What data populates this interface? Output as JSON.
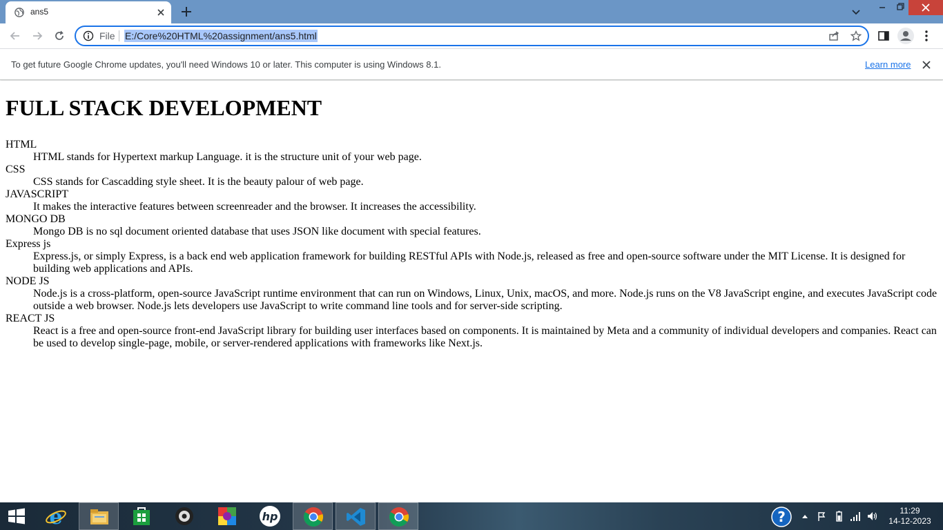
{
  "browser": {
    "tab_title": "ans5",
    "address_scheme": "File",
    "url": "E:/Core%20HTML%20assignment/ans5.html"
  },
  "infobar": {
    "message": "To get future Google Chrome updates, you'll need Windows 10 or later. This computer is using Windows 8.1.",
    "link": "Learn more"
  },
  "page": {
    "heading": "FULL STACK DEVELOPMENT",
    "items": [
      {
        "term": "HTML",
        "desc": "HTML stands for Hypertext markup Language. it is the structure unit of your web page."
      },
      {
        "term": "CSS",
        "desc": "CSS stands for Cascadding style sheet. It is the beauty palour of web page."
      },
      {
        "term": "JAVASCRIPT",
        "desc": "It makes the interactive features between screenreader and the browser. It increases the accessibility."
      },
      {
        "term": "MONGO DB",
        "desc": "Mongo DB is no sql document oriented database that uses JSON like document with special features."
      },
      {
        "term": "Express js",
        "desc": "Express.js, or simply Express, is a back end web application framework for building RESTful APIs with Node.js, released as free and open-source software under the MIT License. It is designed for building web applications and APIs."
      },
      {
        "term": "NODE JS",
        "desc": "Node.js is a cross-platform, open-source JavaScript runtime environment that can run on Windows, Linux, Unix, macOS, and more. Node.js runs on the V8 JavaScript engine, and executes JavaScript code outside a web browser. Node.js lets developers use JavaScript to write command line tools and for server-side scripting."
      },
      {
        "term": "REACT JS",
        "desc": "React is a free and open-source front-end JavaScript library for building user interfaces based on components. It is maintained by Meta and a community of individual developers and companies. React can be used to develop single-page, mobile, or server-rendered applications with frameworks like Next.js."
      }
    ]
  },
  "taskbar": {
    "time": "11:29",
    "date": "14-12-2023",
    "apps": [
      "internet-explorer",
      "file-explorer",
      "store",
      "media-player",
      "paint",
      "hp",
      "chrome",
      "vscode",
      "chrome"
    ]
  },
  "colors": {
    "tabstrip": "#6b96c6",
    "accent": "#1a73e8",
    "window_close": "#c8433a"
  }
}
